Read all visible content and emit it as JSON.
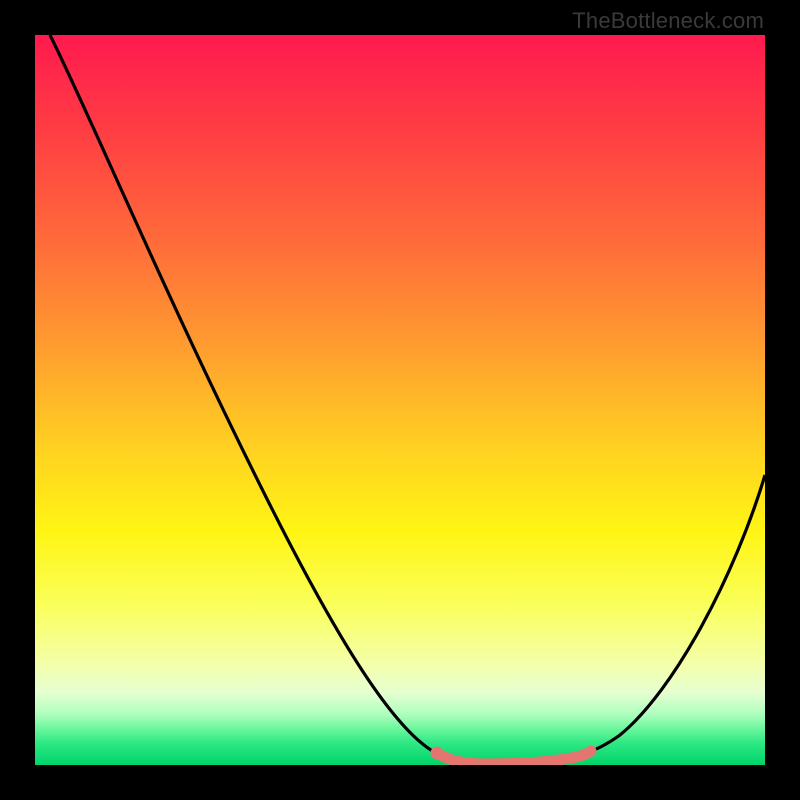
{
  "watermark": "TheBottleneck.com",
  "chart_data": {
    "type": "line",
    "title": "",
    "xlabel": "",
    "ylabel": "",
    "xlim": [
      0,
      100
    ],
    "ylim": [
      0,
      100
    ],
    "x": [
      0,
      5,
      10,
      15,
      20,
      25,
      30,
      35,
      40,
      45,
      50,
      55,
      58,
      60,
      63,
      66,
      70,
      74,
      78,
      82,
      86,
      90,
      94,
      98,
      100
    ],
    "values": [
      100,
      92,
      84,
      76,
      67,
      58,
      49,
      40,
      31,
      22,
      13,
      5,
      1,
      0,
      0,
      0,
      0,
      1,
      4,
      10,
      18,
      27,
      36,
      45,
      50
    ],
    "highlight": {
      "color": "#e4766f",
      "x": [
        55,
        58,
        60,
        63,
        66,
        70,
        74
      ],
      "values": [
        5,
        1,
        0,
        0,
        0,
        0,
        1
      ]
    },
    "background_gradient": {
      "top": "#ff1a4f",
      "mid": "#fff514",
      "bottom": "#00d46a"
    }
  }
}
